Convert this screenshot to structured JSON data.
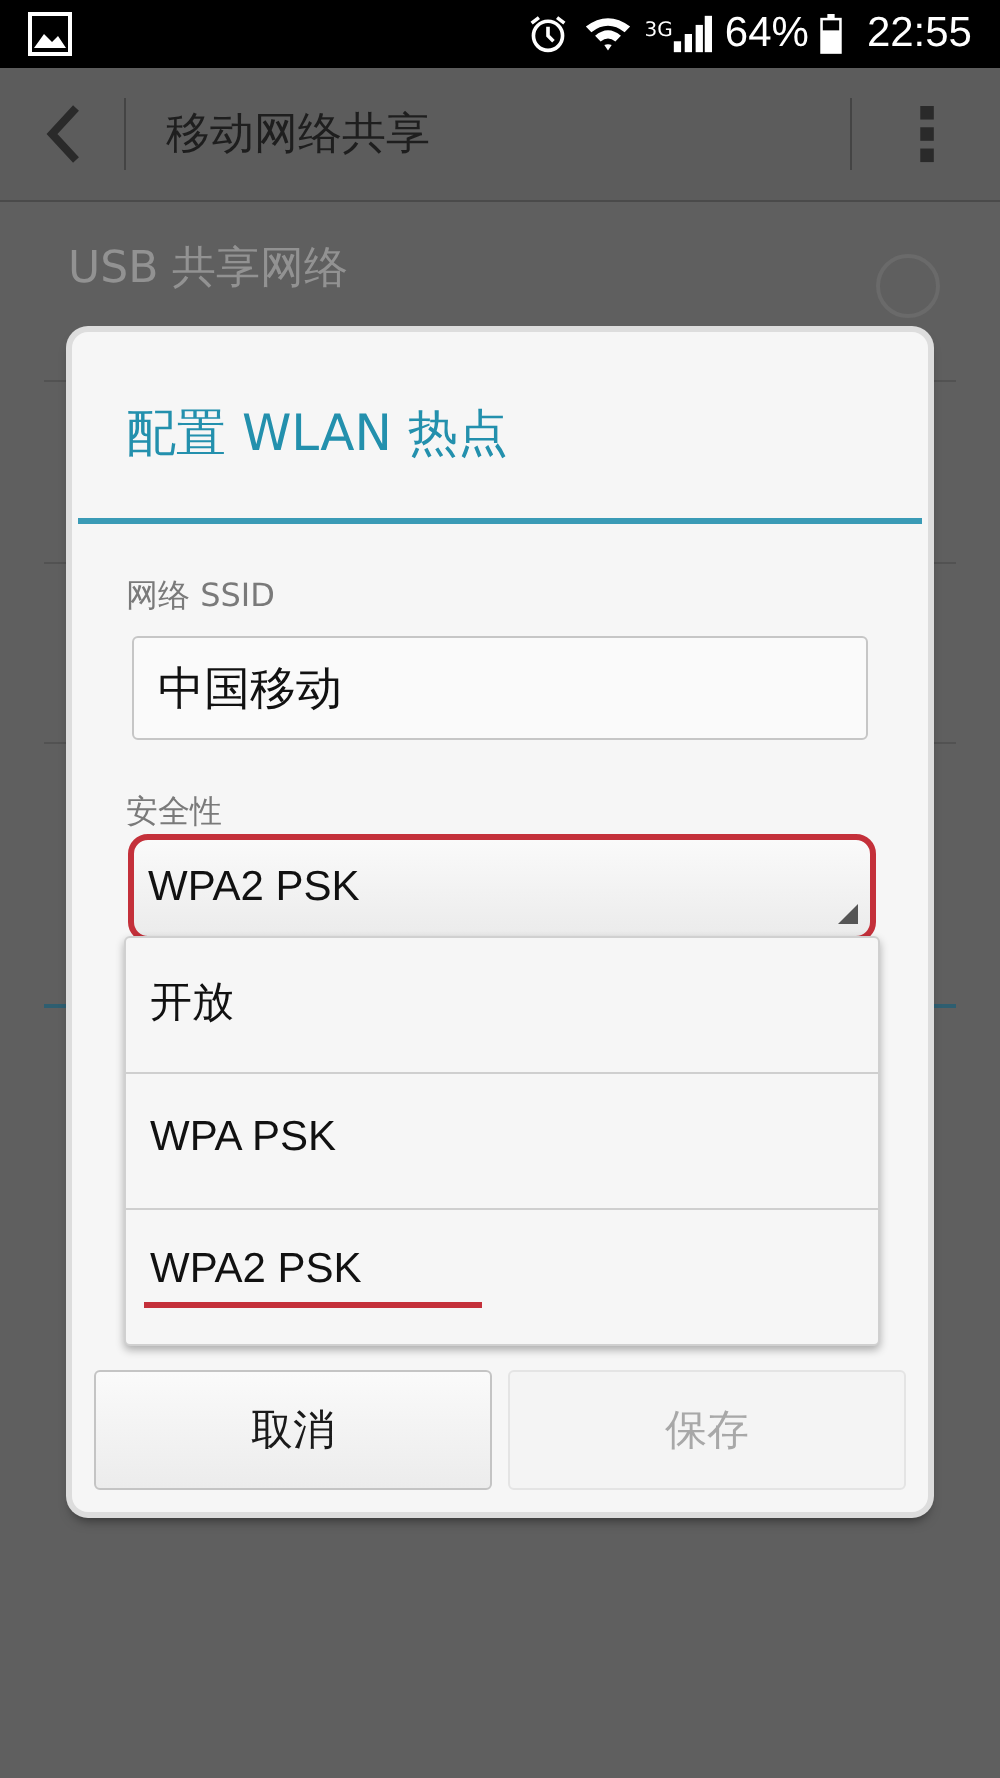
{
  "status_bar": {
    "time": "22:55",
    "battery": "64%",
    "network": "3G"
  },
  "action_bar": {
    "title": "移动网络共享"
  },
  "background_list": [
    {
      "title": "USB 共享网络",
      "checked": false
    }
  ],
  "dialog": {
    "title": "配置 WLAN 热点",
    "ssid": {
      "label": "网络 SSID",
      "value": "中国移动"
    },
    "security": {
      "label": "安全性",
      "value": "WPA2 PSK",
      "highlighted": true
    },
    "options": [
      {
        "label": "开放",
        "underlined": false
      },
      {
        "label": "WPA PSK",
        "underlined": false
      },
      {
        "label": "WPA2 PSK",
        "underlined": true
      }
    ],
    "buttons": [
      {
        "label": "取消",
        "disabled": false
      },
      {
        "label": "保存",
        "disabled": true
      }
    ]
  }
}
